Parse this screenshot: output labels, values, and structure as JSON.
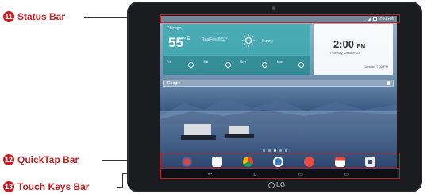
{
  "callouts": [
    {
      "number": "11",
      "label": "Status Bar"
    },
    {
      "number": "12",
      "label": "QuickTap Bar"
    },
    {
      "number": "13",
      "label": "Touch Keys Bar"
    }
  ],
  "accent_color": "#c41e24",
  "tablet": {
    "brand": "LG",
    "status_bar": {
      "time": "2:00 PM"
    },
    "weather": {
      "location": "Chicago",
      "temperature": "55",
      "unit": "°F",
      "feels_like": "RealFeel® 52°",
      "condition": "Sunny",
      "forecast": [
        "Fri",
        "Sat",
        "Sun",
        "Mon"
      ]
    },
    "clock": {
      "time": "2:00",
      "ampm": "PM",
      "date": "Thursday, October 23",
      "alarm": "Tuesday 7:00 PM"
    },
    "search": {
      "placeholder": "Google"
    },
    "quicktap_icons": [
      "apps-icon",
      "play-store-icon",
      "chrome-icon",
      "messaging-icon",
      "camera-icon",
      "calendar-icon",
      "screen-capture-icon"
    ],
    "touch_keys": [
      "back-key",
      "home-key",
      "recent-apps-key",
      "menu-key"
    ]
  }
}
